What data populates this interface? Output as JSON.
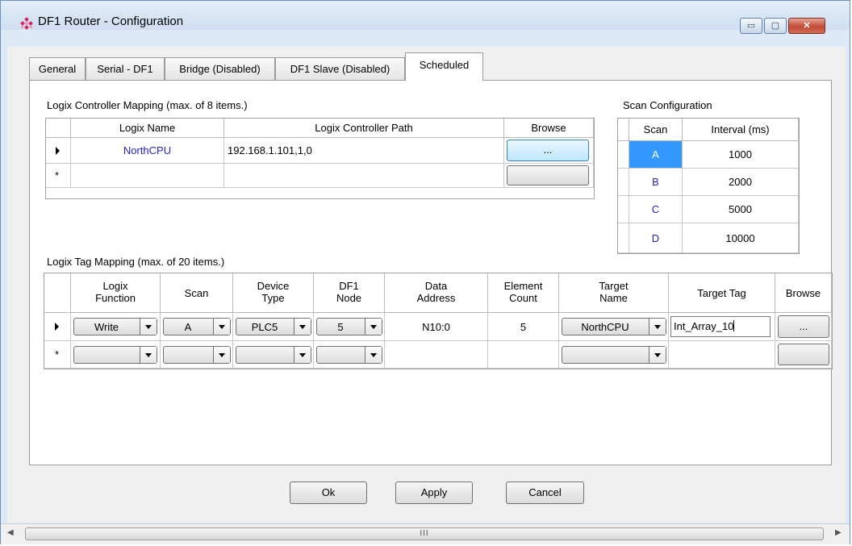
{
  "window": {
    "title": "DF1 Router - Configuration"
  },
  "caption": {
    "minimize": "▭",
    "maximize": "▢",
    "close": "✕"
  },
  "tabs": [
    "General",
    "Serial - DF1",
    "Bridge (Disabled)",
    "DF1 Slave (Disabled)",
    "Scheduled"
  ],
  "controller_mapping": {
    "label": "Logix Controller Mapping (max. of 8 items.)",
    "headers": [
      "Logix Name",
      "Logix Controller Path",
      "Browse"
    ],
    "rows": [
      {
        "name": "NorthCPU",
        "path": "192.168.1.101,1,0",
        "browse": "..."
      },
      {
        "name": "",
        "path": "",
        "browse": ""
      }
    ]
  },
  "scan_config": {
    "label": "Scan Configuration",
    "headers": [
      "Scan",
      "Interval (ms)"
    ],
    "rows": [
      {
        "scan": "A",
        "interval": "1000"
      },
      {
        "scan": "B",
        "interval": "2000"
      },
      {
        "scan": "C",
        "interval": "5000"
      },
      {
        "scan": "D",
        "interval": "10000"
      }
    ]
  },
  "tag_mapping": {
    "label": "Logix Tag Mapping (max. of 20 items.)",
    "headers": [
      "Logix\nFunction",
      "Scan",
      "Device\nType",
      "DF1\nNode",
      "Data\nAddress",
      "Element\nCount",
      "Target\nName",
      "Target Tag",
      "Browse"
    ],
    "rows": [
      {
        "function": "Write",
        "scan": "A",
        "device": "PLC5",
        "node": "5",
        "address": "N10:0",
        "count": "5",
        "target": "NorthCPU",
        "tag": "Int_Array_10",
        "browse": "..."
      },
      {
        "function": "",
        "scan": "",
        "device": "",
        "node": "",
        "address": "",
        "count": "",
        "target": "",
        "tag": "",
        "browse": ""
      }
    ]
  },
  "buttons": {
    "ok": "Ok",
    "apply": "Apply",
    "cancel": "Cancel"
  },
  "scrollbar": {
    "grip": "III"
  },
  "colors": {
    "link_blue": "#1f1fcf",
    "selection": "#3399ff"
  }
}
